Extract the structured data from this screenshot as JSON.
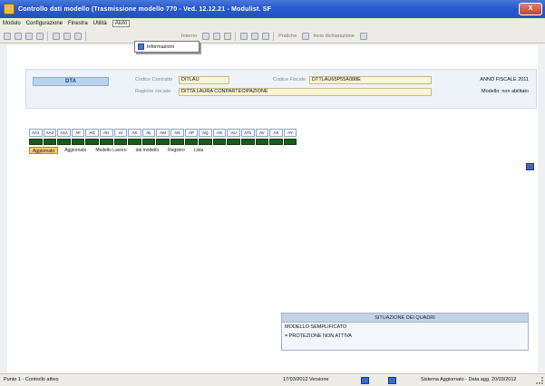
{
  "window": {
    "title": "Controllo dati modello (Trasmissione modello 770 - Ved. 12.12.21 - Modulist. SF",
    "close_label": "X"
  },
  "menubar": {
    "items": [
      "Modulo",
      "Configurazione",
      "Finestra",
      "Utilità",
      "Aiuto"
    ]
  },
  "dropdown": {
    "item_label": "Informazioni",
    "item_icon": "info-icon"
  },
  "toolbar": {
    "text_items": [
      "Interno",
      "Pratiche",
      "Invio dichiarazione"
    ]
  },
  "header": {
    "dichiarazione_label": "DTA",
    "codice_contratto_label": "Codice Contratto",
    "codice_contratto_value": "DITLAU",
    "codice_fiscale_label": "Codice Fiscale",
    "codice_fiscale_value": "DTTLAU65P55A088E",
    "ragione_sociale_label": "Ragione sociale",
    "ragione_sociale_value": "DITTA LAURA CONPARTECIPAZIONE",
    "anno_fiscale": "ANNO FISCALE 2011",
    "modello_status": "Modello: non abilitato"
  },
  "quadri": [
    "AA1",
    "AA2",
    "A1A",
    "AF",
    "AG",
    "AH",
    "AI",
    "AK",
    "AL",
    "AM",
    "AN",
    "AP",
    "AQ",
    "AS",
    "AU",
    "AT1",
    "AV",
    "AX",
    "AY"
  ],
  "tabs": [
    "Aggiornato",
    "Aggiornato",
    "Modello Lavoro",
    "dal modello",
    "Registro",
    "Lista"
  ],
  "situazione": {
    "title": "SITUAZIONE DEI QUADRI",
    "lines": [
      "MODELLO SEMPLIFICATO",
      "= PROTEZIONE NON ATTIVA"
    ]
  },
  "statusbar": {
    "left_text": "Punto 1 - Controllo attivo",
    "mid_text": "17/03/2012   Versione",
    "right_text": "Sistema Aggiornato - Data agg. 20/03/2012"
  },
  "colors": {
    "titlebar": "#2a5ad0",
    "grid_cell": "#175c1a",
    "field_bg": "#fbf4d5",
    "active_tab": "#f3c870"
  }
}
